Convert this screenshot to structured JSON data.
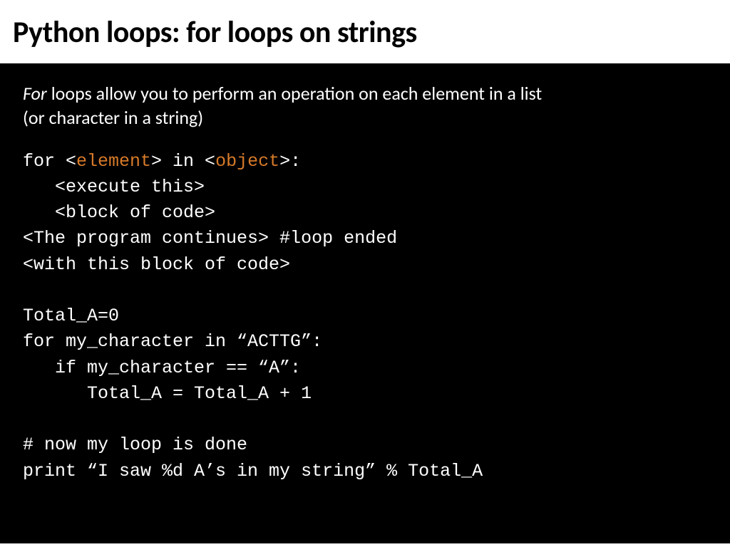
{
  "title": "Python loops: for loops on strings",
  "intro_italic": "For",
  "intro_rest": " loops allow you to perform an operation on each element in a list (or character in a string)",
  "code": {
    "l1a": "for <",
    "l1b": "element",
    "l1c": "> in <",
    "l1d": "object",
    "l1e": ">:",
    "l2": "   <execute this>",
    "l3": "   <block of code>",
    "l4": "<The program continues> #loop ended",
    "l5": "<with this block of code>",
    "blank": "",
    "l6": "Total_A=0",
    "l7": "for my_character in “ACTTG”:",
    "l8": "   if my_character == “A”:",
    "l9": "      Total_A = Total_A + 1",
    "l10": "# now my loop is done",
    "l11": "print “I saw %d A’s in my string” % Total_A"
  }
}
